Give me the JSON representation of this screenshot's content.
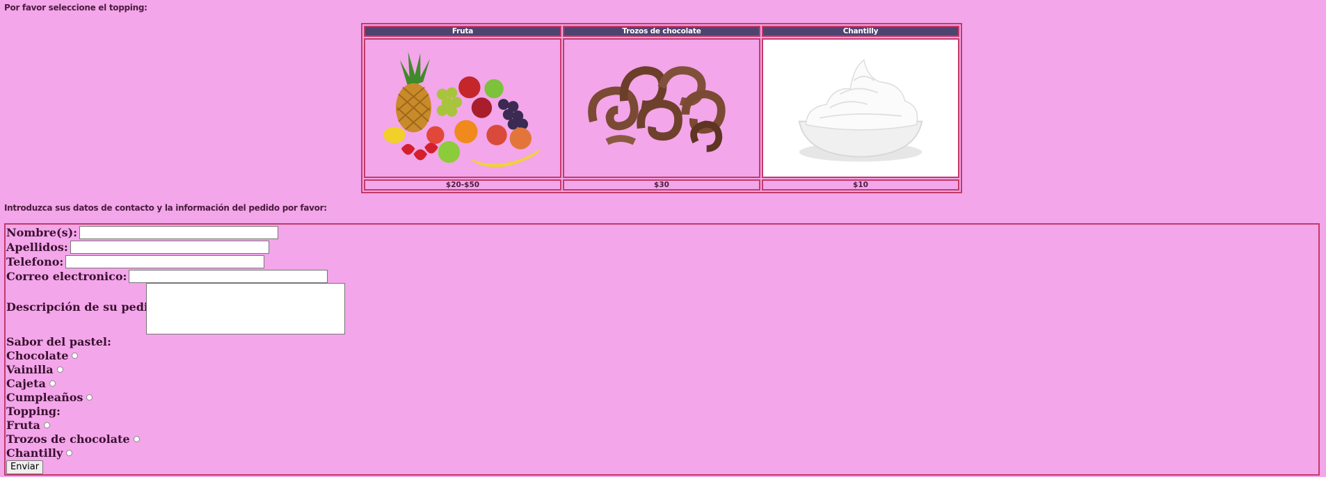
{
  "intro_text": "Por favor seleccione el topping:",
  "toppings_table": {
    "headers": [
      "Fruta",
      "Trozos de chocolate",
      "Chantilly"
    ],
    "prices": [
      "$20-$50",
      "$30",
      "$10"
    ],
    "images": [
      "fruit-image",
      "chocolate-curls-image",
      "whipped-cream-image"
    ]
  },
  "contact_intro": "Introduzca sus datos de contacto y la información del pedido por favor:",
  "form": {
    "nombre_label": "Nombre(s):",
    "apellidos_label": "Apellidos:",
    "telefono_label": "Telefono:",
    "correo_label": "Correo electronico:",
    "descripcion_label": "Descripción de su pedido:",
    "sabor_label": "Sabor del pastel:",
    "sabor_options": [
      "Chocolate",
      "Vainilla",
      "Cajeta",
      "Cumpleaños"
    ],
    "topping_label": "Topping:",
    "topping_options": [
      "Fruta",
      "Trozos de chocolate",
      "Chantilly"
    ],
    "submit_label": "Enviar"
  },
  "colors": {
    "background": "#f3a6e9",
    "header_bg": "#4f4470",
    "border": "#c23a6a"
  }
}
